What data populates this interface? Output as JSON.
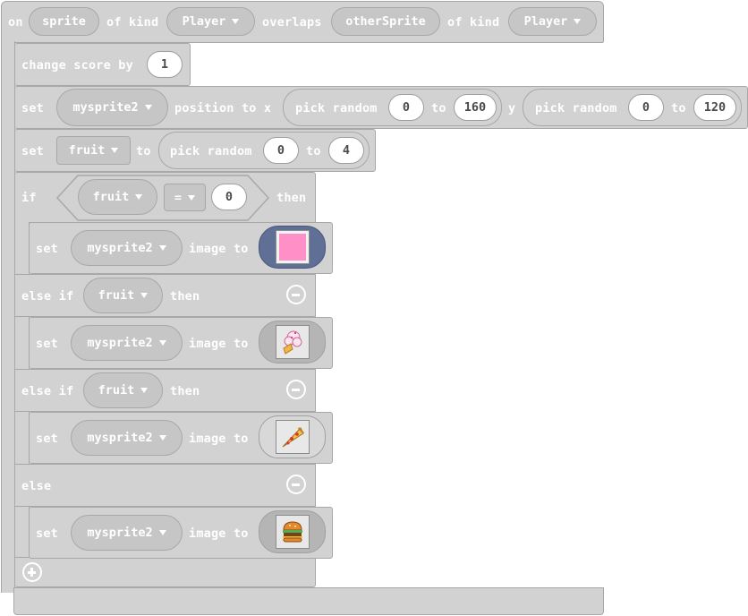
{
  "event": {
    "on": "on",
    "sprite_var": "sprite",
    "of_kind": "of kind",
    "kind1": "Player",
    "overlaps": "overlaps",
    "other_var": "otherSprite",
    "of_kind2": "of kind",
    "kind2": "Player"
  },
  "change_score": {
    "label": "change score by",
    "value": "1"
  },
  "set_position": {
    "set": "set",
    "sprite": "mysprite2",
    "position_to_x": "position to x",
    "pick_random": "pick random",
    "x_min": "0",
    "to": "to",
    "x_max": "160",
    "y": "y",
    "pick_random2": "pick random",
    "y_min": "0",
    "to2": "to",
    "y_max": "120"
  },
  "set_fruit": {
    "set": "set",
    "var": "fruit",
    "to": "to",
    "pick_random": "pick random",
    "min": "0",
    "to2": "to",
    "max": "4"
  },
  "if_block": {
    "if": "if",
    "var": "fruit",
    "op": "=",
    "value": "0",
    "then": "then",
    "else_if": "else if",
    "else": "else"
  },
  "branches": [
    {
      "set": "set",
      "sprite": "mysprite2",
      "image_to": "image to",
      "image": "pink-square-image"
    },
    {
      "cond_var": "fruit",
      "then": "then",
      "set": "set",
      "sprite": "mysprite2",
      "image_to": "image to",
      "image": "ice-cream-image"
    },
    {
      "cond_var": "fruit",
      "then": "then",
      "set": "set",
      "sprite": "mysprite2",
      "image_to": "image to",
      "image": "pizza-image"
    },
    {
      "set": "set",
      "sprite": "mysprite2",
      "image_to": "image to",
      "image": "burger-image"
    }
  ],
  "colors": {
    "block": "#d2d2d2",
    "border": "#a8a8a8",
    "selected_slot": "#5f6f96",
    "pink": "#ff8fc7"
  }
}
